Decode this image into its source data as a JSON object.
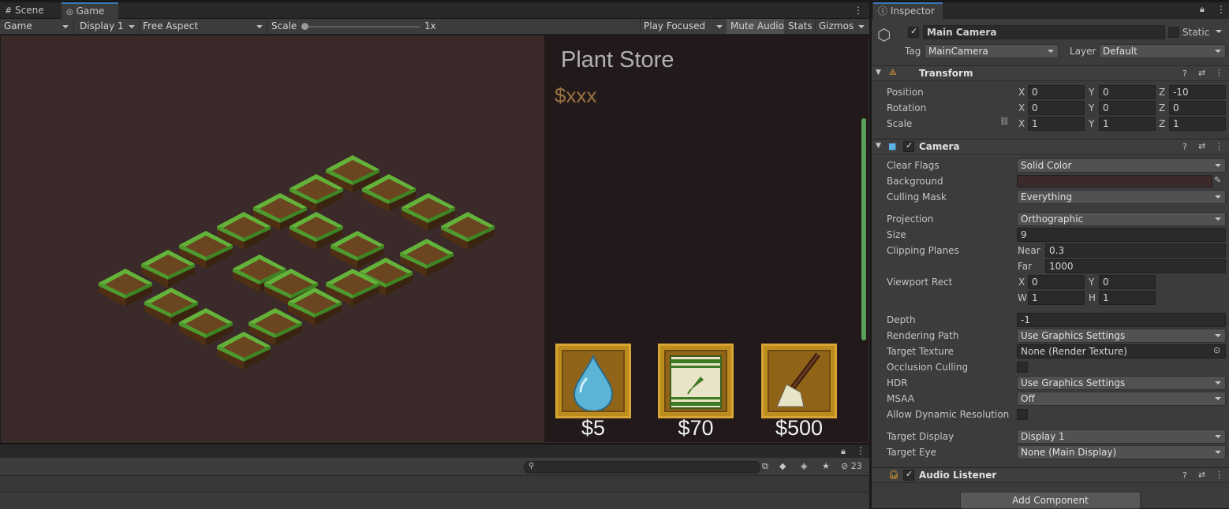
{
  "tabs": {
    "scene": "Scene",
    "game": "Game"
  },
  "toolbar": {
    "game": "Game",
    "display": "Display 1",
    "aspect": "Free Aspect",
    "scale_label": "Scale",
    "scale_value": "1x",
    "play": "Play Focused",
    "mute": "Mute Audio",
    "stats": "Stats",
    "gizmos": "Gizmos"
  },
  "store": {
    "title": "Plant Store",
    "money": "$xxx",
    "items": [
      {
        "name": "water",
        "price": "$5"
      },
      {
        "name": "seed",
        "price": "$70"
      },
      {
        "name": "shovel",
        "price": "$500"
      }
    ]
  },
  "bottom": {
    "hidden_count": "23"
  },
  "inspector": {
    "tab": "Inspector",
    "object_name": "Main Camera",
    "static_label": "Static",
    "tag_label": "Tag",
    "tag": "MainCamera",
    "layer_label": "Layer",
    "layer": "Default",
    "transform": {
      "title": "Transform",
      "position_label": "Position",
      "rotation_label": "Rotation",
      "scale_label": "Scale",
      "axis": {
        "x": "X",
        "y": "Y",
        "z": "Z"
      },
      "position": {
        "x": "0",
        "y": "0",
        "z": "-10"
      },
      "rotation": {
        "x": "0",
        "y": "0",
        "z": "0"
      },
      "scale": {
        "x": "1",
        "y": "1",
        "z": "1"
      }
    },
    "camera": {
      "title": "Camera",
      "clear_flags_label": "Clear Flags",
      "clear_flags": "Solid Color",
      "background_label": "Background",
      "background_color": "#3a2a2a",
      "culling_label": "Culling Mask",
      "culling": "Everything",
      "projection_label": "Projection",
      "projection": "Orthographic",
      "size_label": "Size",
      "size": "9",
      "clipping_label": "Clipping Planes",
      "near_label": "Near",
      "near": "0.3",
      "far_label": "Far",
      "far": "1000",
      "viewport_label": "Viewport Rect",
      "vx": "0",
      "vy": "0",
      "vw": "1",
      "vh": "1",
      "w_label": "W",
      "h_label": "H",
      "depth_label": "Depth",
      "depth": "-1",
      "rpath_label": "Rendering Path",
      "rpath": "Use Graphics Settings",
      "ttex_label": "Target Texture",
      "ttex": "None (Render Texture)",
      "occlusion_label": "Occlusion Culling",
      "hdr_label": "HDR",
      "hdr": "Use Graphics Settings",
      "msaa_label": "MSAA",
      "msaa": "Off",
      "dynres_label": "Allow Dynamic Resolution",
      "tdisplay_label": "Target Display",
      "tdisplay": "Display 1",
      "teye_label": "Target Eye",
      "teye": "None (Main Display)"
    },
    "audio": {
      "title": "Audio Listener"
    },
    "add_component": "Add Component"
  }
}
